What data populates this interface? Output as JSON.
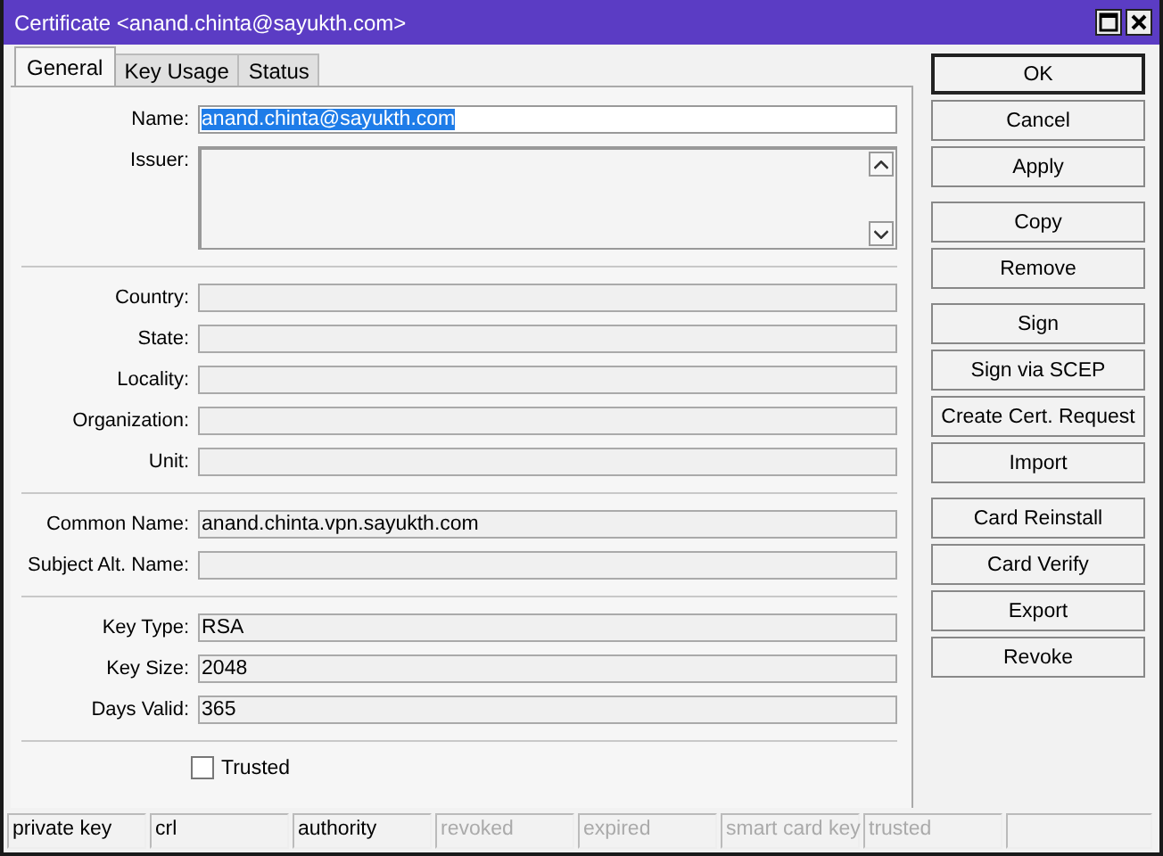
{
  "window": {
    "title": "Certificate <anand.chinta@sayukth.com>"
  },
  "tabs": [
    {
      "label": "General",
      "selected": true
    },
    {
      "label": "Key Usage",
      "selected": false
    },
    {
      "label": "Status",
      "selected": false
    }
  ],
  "field_groups": [
    [
      {
        "kind": "text",
        "label": "Name:",
        "value": "anand.chinta@sayukth.com",
        "disabled": false,
        "highlighted": true
      },
      {
        "kind": "textarea",
        "label": "Issuer:"
      }
    ],
    [
      {
        "kind": "text",
        "label": "Country:",
        "disabled": true
      },
      {
        "kind": "text",
        "label": "State:",
        "disabled": true
      },
      {
        "kind": "text",
        "label": "Locality:",
        "disabled": true
      },
      {
        "kind": "text",
        "label": "Organization:",
        "disabled": true
      },
      {
        "kind": "text",
        "label": "Unit:",
        "disabled": true
      }
    ],
    [
      {
        "kind": "text",
        "label": "Common Name:",
        "value": "anand.chinta.vpn.sayukth.com",
        "disabled": true
      },
      {
        "kind": "text",
        "label": "Subject Alt. Name:",
        "disabled": true
      }
    ],
    [
      {
        "kind": "text",
        "label": "Key Type:",
        "value": "RSA",
        "disabled": true
      },
      {
        "kind": "text",
        "label": "Key Size:",
        "value": "2048",
        "disabled": true
      },
      {
        "kind": "text",
        "label": "Days Valid:",
        "value": "365",
        "disabled": true
      }
    ]
  ],
  "trusted": {
    "label": "Trusted",
    "checked": false
  },
  "button_groups": [
    [
      {
        "label": "OK",
        "default": true
      },
      {
        "label": "Cancel",
        "default": false
      },
      {
        "label": "Apply",
        "default": false
      }
    ],
    [
      {
        "label": "Copy",
        "default": false
      },
      {
        "label": "Remove",
        "default": false
      }
    ],
    [
      {
        "label": "Sign",
        "default": false
      },
      {
        "label": "Sign via SCEP",
        "default": false
      },
      {
        "label": "Create Cert. Request",
        "default": false
      },
      {
        "label": "Import",
        "default": false
      }
    ],
    [
      {
        "label": "Card Reinstall",
        "default": false
      },
      {
        "label": "Card Verify",
        "default": false
      },
      {
        "label": "Export",
        "default": false
      },
      {
        "label": "Revoke",
        "default": false
      }
    ]
  ],
  "status_bar": [
    {
      "label": "private key",
      "active": true
    },
    {
      "label": "crl",
      "active": true
    },
    {
      "label": "authority",
      "active": true
    },
    {
      "label": "revoked",
      "active": false
    },
    {
      "label": "expired",
      "active": false
    },
    {
      "label": "smart card key",
      "active": false
    },
    {
      "label": "trusted",
      "active": false
    }
  ]
}
